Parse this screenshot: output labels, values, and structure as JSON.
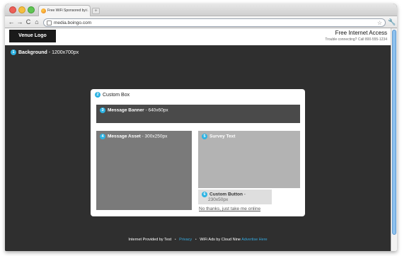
{
  "browser": {
    "tab_title": "Free WiFi Sponsored by...",
    "tab_close": "×",
    "new_tab": "+",
    "url": "media.boingo.com",
    "nav": {
      "back": "←",
      "forward": "→",
      "reload": "C",
      "home": "⌂"
    },
    "star": "☆",
    "wrench": "🔧"
  },
  "header": {
    "logo": "Venue Logo",
    "title": "Free Internet Access",
    "subtitle": "Trouble connecting? Call 800-555-1234"
  },
  "background": {
    "num": "1",
    "name": "Background",
    "dim": " - 1200x700px"
  },
  "custom_box": {
    "num": "2",
    "name": "Custom Box"
  },
  "message_banner": {
    "num": "3",
    "name": "Message Banner",
    "dim": " - 640x60px"
  },
  "message_asset": {
    "num": "4",
    "name": "Message Asset",
    "dim": " - 300x250px"
  },
  "survey": {
    "num": "5",
    "name": "Survey Text"
  },
  "custom_button": {
    "num": "6",
    "name": "Custom Button",
    "sep": " -",
    "dim": "230x50px"
  },
  "no_thanks": "No thanks, just take me online",
  "footer": {
    "provided_by": "Internet Provided by Test",
    "dot1": "•",
    "privacy": "Privacy",
    "dot2": "•",
    "ads_by": "WiFi Ads by Cloud Nine",
    "advertise": "Advertise Here"
  }
}
